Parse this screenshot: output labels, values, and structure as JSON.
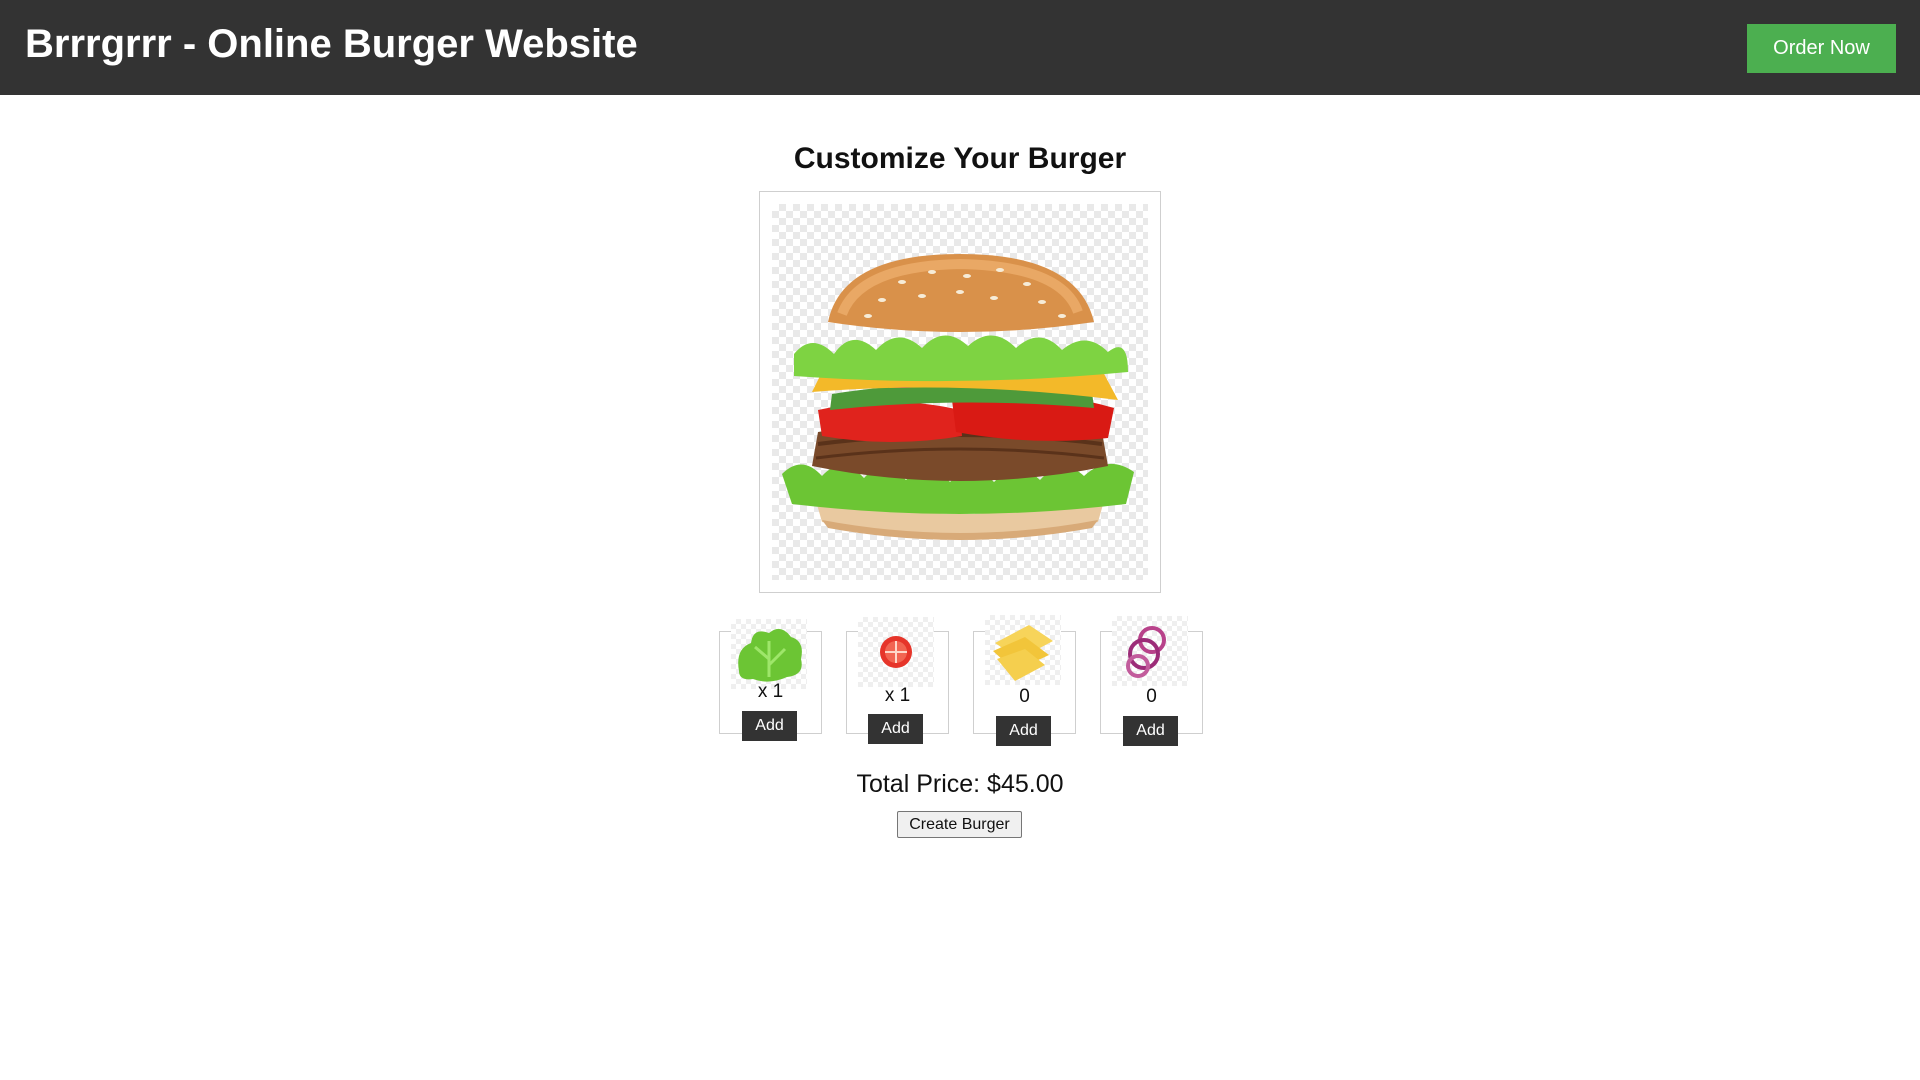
{
  "header": {
    "title": "Brrrgrrr - Online Burger Website",
    "order_button": "Order Now"
  },
  "main": {
    "title": "Customize Your Burger",
    "burger_image": "burger-image"
  },
  "ingredients": [
    {
      "icon": "lettuce-icon",
      "quantity": "x 1",
      "add_label": "Add"
    },
    {
      "icon": "tomato-icon",
      "quantity": "x 1",
      "add_label": "Add"
    },
    {
      "icon": "cheese-icon",
      "quantity": "0",
      "add_label": "Add"
    },
    {
      "icon": "onion-icon",
      "quantity": "0",
      "add_label": "Add"
    }
  ],
  "total_price": "Total Price: $45.00",
  "create_button": "Create Burger",
  "colors": {
    "header_bg": "#333333",
    "accent_green": "#4caf50",
    "add_button_bg": "#333333"
  }
}
